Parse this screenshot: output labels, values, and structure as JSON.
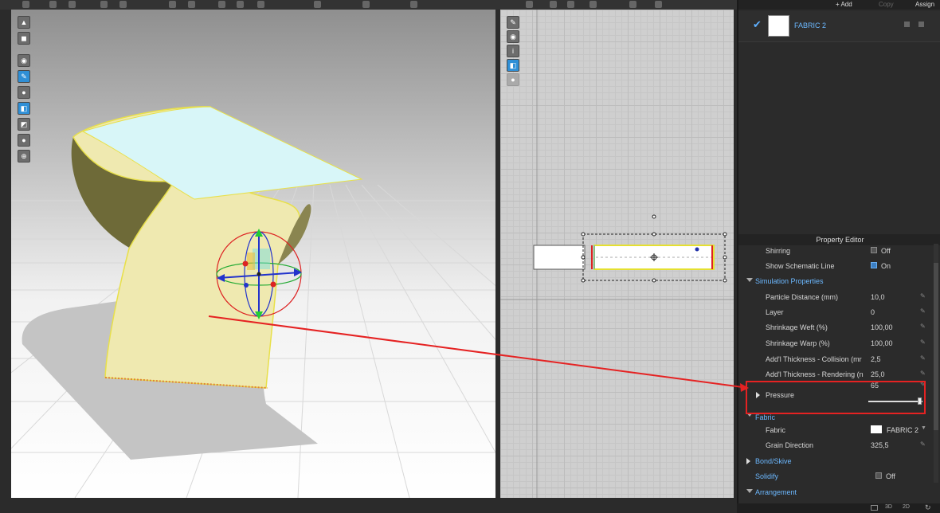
{
  "browser": {
    "add_label": "+ Add",
    "copy_label": "Copy",
    "assign_label": "Assign",
    "fabric_name": "FABRIC 2"
  },
  "property_editor": {
    "title": "Property Editor",
    "rows": {
      "shirring": {
        "label": "Shirring",
        "value": "Off"
      },
      "schematic": {
        "label": "Show Schematic Line",
        "value": "On"
      },
      "sim_section": {
        "label": "Simulation Properties"
      },
      "particle": {
        "label": "Particle Distance (mm)",
        "value": "10,0"
      },
      "layer": {
        "label": "Layer",
        "value": "0"
      },
      "weft": {
        "label": "Shrinkage Weft (%)",
        "value": "100,00"
      },
      "warp": {
        "label": "Shrinkage Warp (%)",
        "value": "100,00"
      },
      "collision": {
        "label": "Add'l Thickness - Collision (mr",
        "value": "2,5"
      },
      "rendering": {
        "label": "Add'l Thickness - Rendering (n",
        "value": "25,0"
      },
      "pressure": {
        "label": "Pressure",
        "value": "65"
      },
      "fabric_section": {
        "label": "Fabric"
      },
      "fabric": {
        "label": "Fabric",
        "value": "FABRIC 2"
      },
      "grain": {
        "label": "Grain Direction",
        "value": "325,5"
      },
      "bond": {
        "label": "Bond/Skive"
      },
      "solidify": {
        "label": "Solidify",
        "value": "Off"
      },
      "arrangement": {
        "label": "Arrangement"
      }
    }
  },
  "bottom_bar": {
    "view_3d": "3D",
    "view_2d": "2D"
  },
  "colors": {
    "accent": "#6cb8ff",
    "highlight": "#e52222",
    "fabric_yellow": "#efe9b0",
    "fabric_cyan": "#d8f6f8"
  }
}
